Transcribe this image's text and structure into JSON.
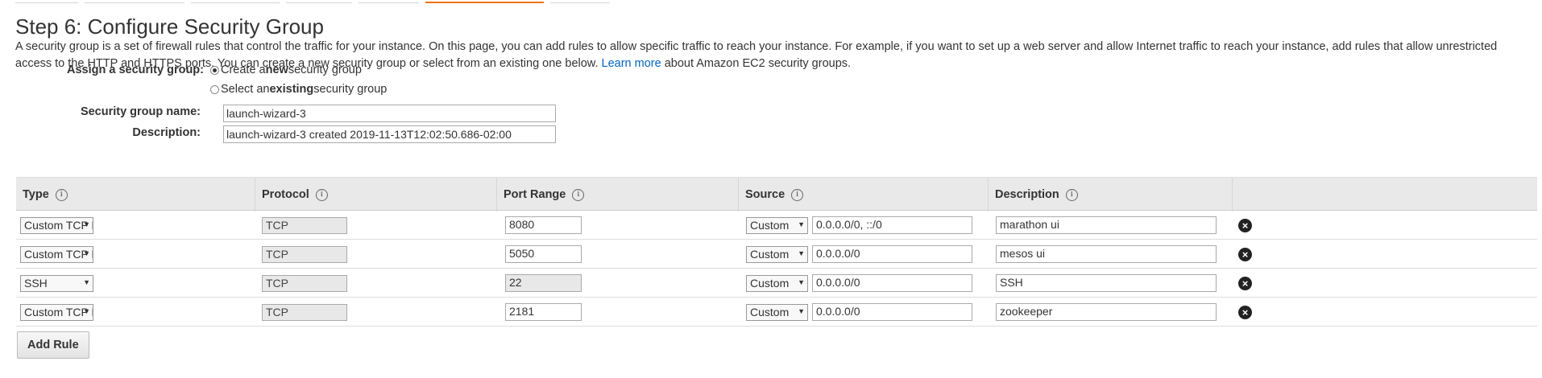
{
  "page": {
    "title": "Step 6: Configure Security Group",
    "intro_text": "A security group is a set of firewall rules that control the traffic for your instance. On this page, you can add rules to allow specific traffic to reach your instance. For example, if you want to set up a web server and allow Internet traffic to reach your instance, add rules that allow unrestricted access to the HTTP and HTTPS ports. You can create a new security group or select from an existing one below.",
    "learn_more_link": "Learn more",
    "intro_suffix": "about Amazon EC2 security groups."
  },
  "assign": {
    "label": "Assign a security group:",
    "option_new_prefix": "Create a ",
    "option_new_bold": "new",
    "option_new_suffix": " security group",
    "option_existing_prefix": "Select an ",
    "option_existing_bold": "existing",
    "option_existing_suffix": " security group",
    "selected": "new"
  },
  "group_name": {
    "label": "Security group name:",
    "value": "launch-wizard-3"
  },
  "description": {
    "label": "Description:",
    "value": "launch-wizard-3 created 2019-11-13T12:02:50.686-02:00"
  },
  "table": {
    "headers": {
      "type": "Type",
      "protocol": "Protocol",
      "port_range": "Port Range",
      "source": "Source",
      "description": "Description"
    },
    "info_icon": "info-icon",
    "rows": [
      {
        "type": "Custom TCP F",
        "protocol": "TCP",
        "port": "8080",
        "port_disabled": false,
        "source_type": "Custom",
        "source": "0.0.0.0/0, ::/0",
        "description": "marathon ui"
      },
      {
        "type": "Custom TCP F",
        "protocol": "TCP",
        "port": "5050",
        "port_disabled": false,
        "source_type": "Custom",
        "source": "0.0.0.0/0",
        "description": "mesos ui"
      },
      {
        "type": "SSH",
        "protocol": "TCP",
        "port": "22",
        "port_disabled": true,
        "source_type": "Custom",
        "source": "0.0.0.0/0",
        "description": "SSH"
      },
      {
        "type": "Custom TCP F",
        "protocol": "TCP",
        "port": "2181",
        "port_disabled": false,
        "source_type": "Custom",
        "source": "0.0.0.0/0",
        "description": "zookeeper"
      }
    ]
  },
  "actions": {
    "add_rule": "Add Rule"
  },
  "colors": {
    "accent": "#ec7211",
    "link": "#0066c0",
    "header_bg": "#e9e9e9"
  }
}
